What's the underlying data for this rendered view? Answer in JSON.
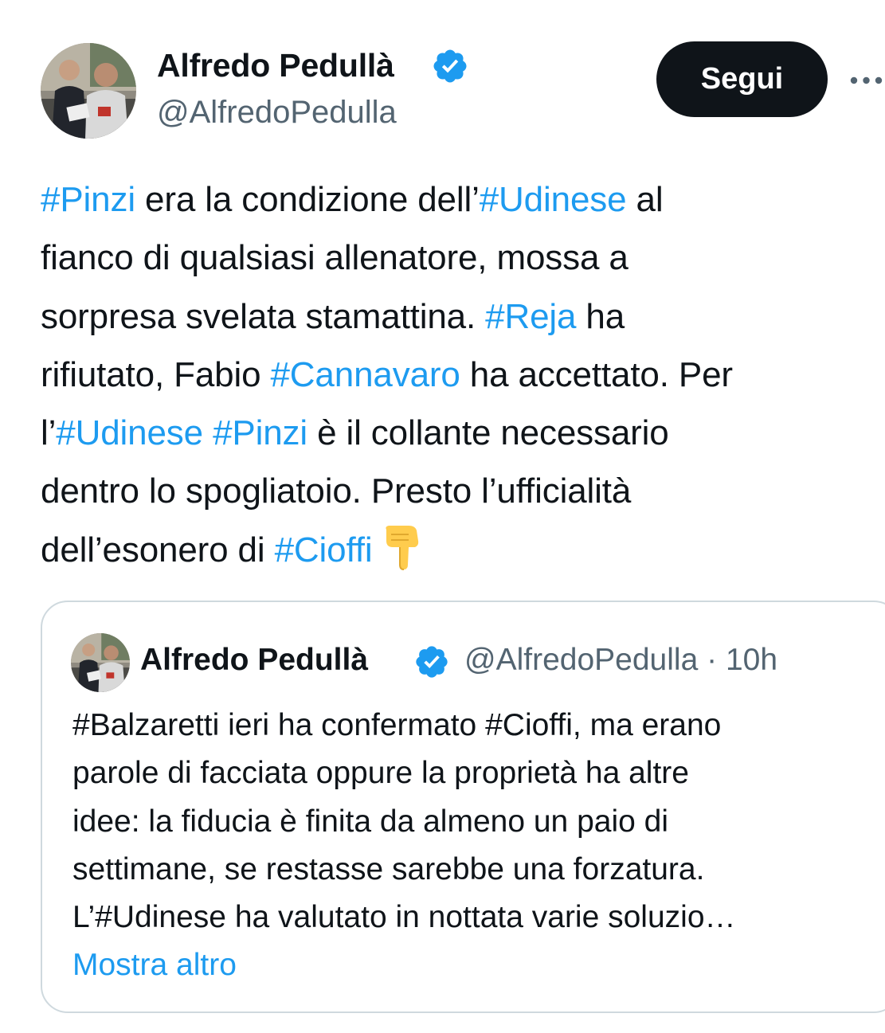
{
  "tweet": {
    "author": {
      "display_name": "Alfredo Pedullà",
      "handle": "@AlfredoPedulla",
      "verified": true
    },
    "follow_label": "Segui",
    "more_icon": "more-horizontal-icon",
    "text_lines": [
      [
        {
          "t": "#Pinzi",
          "tag": true
        },
        {
          "t": " era la condizione dell’",
          "tag": false
        },
        {
          "t": "#Udinese",
          "tag": true
        },
        {
          "t": " al",
          "tag": false
        }
      ],
      [
        {
          "t": "fianco di qualsiasi allenatore, mossa a",
          "tag": false
        }
      ],
      [
        {
          "t": "sorpresa svelata stamattina. ",
          "tag": false
        },
        {
          "t": "#Reja",
          "tag": true
        },
        {
          "t": " ha",
          "tag": false
        }
      ],
      [
        {
          "t": "rifiutato, Fabio ",
          "tag": false
        },
        {
          "t": "#Cannavaro",
          "tag": true
        },
        {
          "t": " ha accettato. Per",
          "tag": false
        }
      ],
      [
        {
          "t": "l’",
          "tag": false
        },
        {
          "t": "#Udinese",
          "tag": true
        },
        {
          "t": " ",
          "tag": false
        },
        {
          "t": "#Pinzi",
          "tag": true
        },
        {
          "t": " è il collante necessario",
          "tag": false
        }
      ],
      [
        {
          "t": "dentro lo spogliatoio. Presto l’ufficialità",
          "tag": false
        }
      ],
      [
        {
          "t": "dell’esonero di ",
          "tag": false
        },
        {
          "t": "#Cioffi",
          "tag": true
        }
      ]
    ],
    "trailing_emoji": "backhand-index-pointing-down-emoji"
  },
  "quoted_tweet": {
    "author": {
      "display_name": "Alfredo Pedullà",
      "handle": "@AlfredoPedulla",
      "verified": true
    },
    "separator": "·",
    "time": "10h",
    "text_lines": [
      "#Balzaretti ieri ha confermato #Cioffi, ma erano",
      "parole di facciata oppure la proprietà ha altre",
      "idee: la fiducia è finita da almeno un paio di",
      "settimane, se restasse sarebbe una forzatura.",
      "L’#Udinese ha valutato in nottata varie soluzio…"
    ],
    "show_more_label": "Mostra altro"
  },
  "colors": {
    "text": "#0f1419",
    "secondary": "#536471",
    "link": "#1d9bf0",
    "verified": "#1d9bf0",
    "button_bg": "#0f1419",
    "border": "#cfd9de"
  }
}
